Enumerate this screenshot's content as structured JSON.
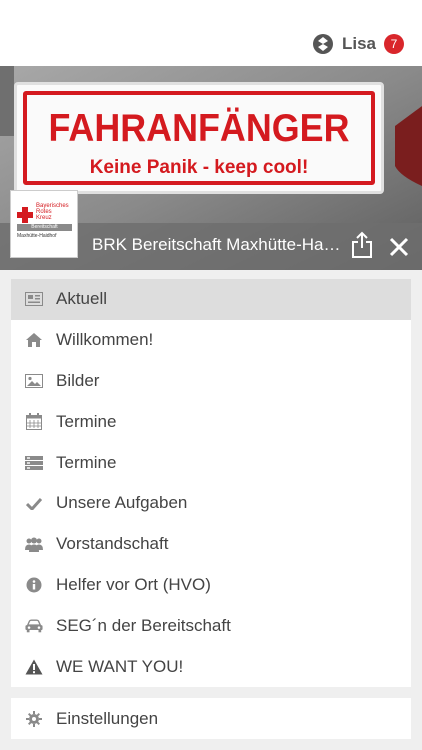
{
  "header": {
    "user_name": "Lisa",
    "notification_count": "7"
  },
  "hero": {
    "sticker_title": "FAHRANFÄNGER",
    "sticker_subtitle": "Keine Panik - keep cool!"
  },
  "logo": {
    "line1": "Bayerisches",
    "line2": "Rotes",
    "line3": "Kreuz",
    "bar": "Bereitschaft",
    "place": "Maxhütte-Haidhof"
  },
  "page": {
    "title": "BRK Bereitschaft Maxhütte-Haidhof"
  },
  "menu": {
    "items": [
      {
        "label": "Aktuell",
        "icon": "newspaper-icon"
      },
      {
        "label": "Willkommen!",
        "icon": "home-icon"
      },
      {
        "label": "Bilder",
        "icon": "image-icon"
      },
      {
        "label": "Termine",
        "icon": "calendar-icon"
      },
      {
        "label": "Termine",
        "icon": "list-icon"
      },
      {
        "label": "Unsere Aufgaben",
        "icon": "check-icon"
      },
      {
        "label": "Vorstandschaft",
        "icon": "group-icon"
      },
      {
        "label": "Helfer vor Ort (HVO)",
        "icon": "info-icon"
      },
      {
        "label": "SEG´n der Bereitschaft",
        "icon": "car-icon"
      },
      {
        "label": "WE WANT YOU!",
        "icon": "warning-icon"
      }
    ]
  },
  "settings": {
    "label": "Einstellungen",
    "icon": "gear-icon"
  },
  "colors": {
    "accent_red": "#d41a1f",
    "badge_red": "#d9262b",
    "text": "#444444",
    "icon_gray": "#8a8a8a"
  }
}
